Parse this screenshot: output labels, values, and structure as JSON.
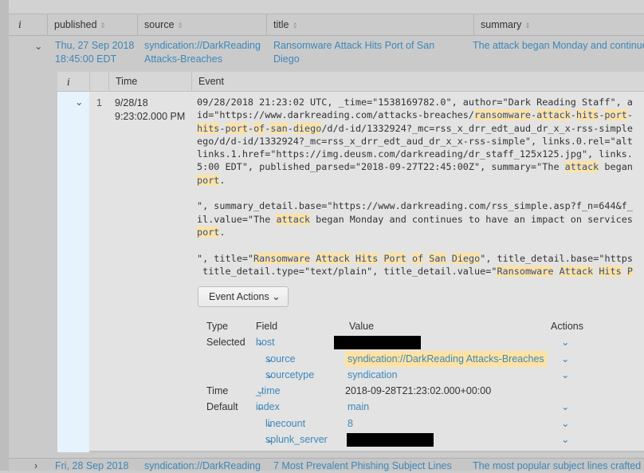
{
  "header": {
    "columns": [
      {
        "label": "i"
      },
      {
        "label": "published"
      },
      {
        "label": "source"
      },
      {
        "label": "title"
      },
      {
        "label": "summary"
      }
    ],
    "sort_icon": "⇕"
  },
  "rows": [
    {
      "published": [
        "Thu, 27 Sep 2018",
        "18:45:00 EDT"
      ],
      "source": [
        "syndication://DarkReading",
        "Attacks-Breaches"
      ],
      "title": [
        "Ransomware Attack Hits Port of San",
        "Diego"
      ],
      "summary": "The attack began Monday and continues to have an impact on services"
    },
    {
      "published": [
        "Fri, 28 Sep 2018"
      ],
      "source": [
        "syndication://DarkReading"
      ],
      "title": [
        "7 Most Prevalent Phishing Subject Lines"
      ],
      "summary": "The most popular subject lines crafted to"
    }
  ],
  "inner": {
    "columns": {
      "i": "i",
      "time": "Time",
      "event": "Event"
    },
    "event_number": "1",
    "time": [
      "9/28/18",
      "9:23:02.000 PM"
    ],
    "event_lines": [
      [
        "09/28/2018 21:23:02 UTC, _time=\"1538169782.0\", author=\"Dark Reading Staff\", a"
      ],
      [
        "id=\"https://www.darkreading.com/attacks-breaches/",
        "ransomware",
        "-",
        "attack",
        "-",
        "hits",
        "-",
        "port",
        "-"
      ],
      [
        "",
        "hits",
        "-",
        "port",
        "-",
        "of",
        "-",
        "san",
        "-",
        "diego",
        "/d/d-id/1332924?_mc=rss_x_drr_edt_aud_dr_x_x-rss-simple"
      ],
      [
        "ego/d/d-id/1332924?_mc=rss_x_drr_edt_aud_dr_x_x-rss-simple\", links.0.rel=\"alt"
      ],
      [
        "links.1.href=\"https://img.deusm.com/darkreading/dr_staff_125x125.jpg\", links."
      ],
      [
        "5:00 EDT\", published_parsed=\"2018-09-27T22:45:00Z\", summary=\"The ",
        "attack",
        " began"
      ],
      [
        "",
        "port",
        "."
      ],
      [
        ""
      ],
      [
        "\", summary_detail.base=\"https://www.darkreading.com/rss_simple.asp?f_n=644&f_"
      ],
      [
        "il.value=\"The ",
        "attack",
        " began Monday and continues to have an impact on services"
      ],
      [
        "",
        "port",
        "."
      ],
      [
        ""
      ],
      [
        "\", title=\"",
        "Ransomware",
        " ",
        "Attack",
        " ",
        "Hits",
        " ",
        "Port",
        " ",
        "of",
        " ",
        "San",
        " ",
        "Diego",
        "\", title_detail.base=\"https"
      ],
      [
        " title_detail.type=\"text/plain\", title_detail.value=\"",
        "Ransomware",
        " ",
        "Attack",
        " ",
        "Hits",
        " ",
        "P"
      ]
    ],
    "event_actions_label": "Event Actions",
    "fields_header": {
      "type": "Type",
      "field": "Field",
      "value": "Value",
      "actions": "Actions"
    },
    "fields": [
      {
        "type": "Selected",
        "field": "host",
        "value": "",
        "redacted": true,
        "indent": false
      },
      {
        "type": "",
        "field": "source",
        "value": "syndication://DarkReading Attacks-Breaches",
        "highlight": true,
        "indent": true
      },
      {
        "type": "",
        "field": "sourcetype",
        "value": "syndication",
        "indent": true
      },
      {
        "type": "Time",
        "field": "_time",
        "value": "2018-09-28T21:23:02.000+00:00",
        "plain": true,
        "noaction": true,
        "indent": false
      },
      {
        "type": "Default",
        "field": "index",
        "value": "main",
        "indent": false
      },
      {
        "type": "",
        "field": "linecount",
        "value": "8",
        "indent": true
      },
      {
        "type": "",
        "field": "splunk_server",
        "value": "",
        "redacted": true,
        "indent": true
      }
    ]
  },
  "colors": {
    "link": "#3d87b8",
    "highlight": "#fde2a4",
    "expanded_cell": "#e6f3fc"
  }
}
